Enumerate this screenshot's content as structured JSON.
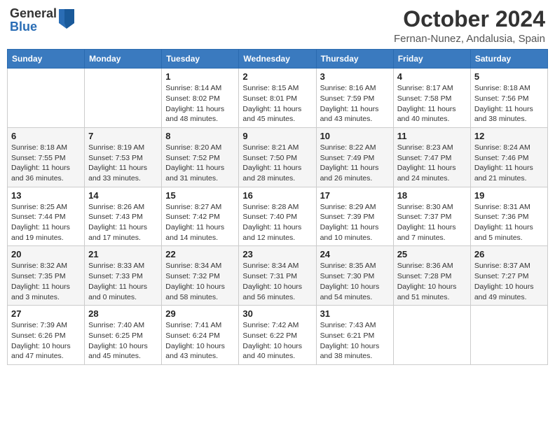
{
  "header": {
    "logo_general": "General",
    "logo_blue": "Blue",
    "month": "October 2024",
    "location": "Fernan-Nunez, Andalusia, Spain"
  },
  "days_of_week": [
    "Sunday",
    "Monday",
    "Tuesday",
    "Wednesday",
    "Thursday",
    "Friday",
    "Saturday"
  ],
  "weeks": [
    [
      {
        "day": "",
        "info": ""
      },
      {
        "day": "",
        "info": ""
      },
      {
        "day": "1",
        "info": "Sunrise: 8:14 AM\nSunset: 8:02 PM\nDaylight: 11 hours and 48 minutes."
      },
      {
        "day": "2",
        "info": "Sunrise: 8:15 AM\nSunset: 8:01 PM\nDaylight: 11 hours and 45 minutes."
      },
      {
        "day": "3",
        "info": "Sunrise: 8:16 AM\nSunset: 7:59 PM\nDaylight: 11 hours and 43 minutes."
      },
      {
        "day": "4",
        "info": "Sunrise: 8:17 AM\nSunset: 7:58 PM\nDaylight: 11 hours and 40 minutes."
      },
      {
        "day": "5",
        "info": "Sunrise: 8:18 AM\nSunset: 7:56 PM\nDaylight: 11 hours and 38 minutes."
      }
    ],
    [
      {
        "day": "6",
        "info": "Sunrise: 8:18 AM\nSunset: 7:55 PM\nDaylight: 11 hours and 36 minutes."
      },
      {
        "day": "7",
        "info": "Sunrise: 8:19 AM\nSunset: 7:53 PM\nDaylight: 11 hours and 33 minutes."
      },
      {
        "day": "8",
        "info": "Sunrise: 8:20 AM\nSunset: 7:52 PM\nDaylight: 11 hours and 31 minutes."
      },
      {
        "day": "9",
        "info": "Sunrise: 8:21 AM\nSunset: 7:50 PM\nDaylight: 11 hours and 28 minutes."
      },
      {
        "day": "10",
        "info": "Sunrise: 8:22 AM\nSunset: 7:49 PM\nDaylight: 11 hours and 26 minutes."
      },
      {
        "day": "11",
        "info": "Sunrise: 8:23 AM\nSunset: 7:47 PM\nDaylight: 11 hours and 24 minutes."
      },
      {
        "day": "12",
        "info": "Sunrise: 8:24 AM\nSunset: 7:46 PM\nDaylight: 11 hours and 21 minutes."
      }
    ],
    [
      {
        "day": "13",
        "info": "Sunrise: 8:25 AM\nSunset: 7:44 PM\nDaylight: 11 hours and 19 minutes."
      },
      {
        "day": "14",
        "info": "Sunrise: 8:26 AM\nSunset: 7:43 PM\nDaylight: 11 hours and 17 minutes."
      },
      {
        "day": "15",
        "info": "Sunrise: 8:27 AM\nSunset: 7:42 PM\nDaylight: 11 hours and 14 minutes."
      },
      {
        "day": "16",
        "info": "Sunrise: 8:28 AM\nSunset: 7:40 PM\nDaylight: 11 hours and 12 minutes."
      },
      {
        "day": "17",
        "info": "Sunrise: 8:29 AM\nSunset: 7:39 PM\nDaylight: 11 hours and 10 minutes."
      },
      {
        "day": "18",
        "info": "Sunrise: 8:30 AM\nSunset: 7:37 PM\nDaylight: 11 hours and 7 minutes."
      },
      {
        "day": "19",
        "info": "Sunrise: 8:31 AM\nSunset: 7:36 PM\nDaylight: 11 hours and 5 minutes."
      }
    ],
    [
      {
        "day": "20",
        "info": "Sunrise: 8:32 AM\nSunset: 7:35 PM\nDaylight: 11 hours and 3 minutes."
      },
      {
        "day": "21",
        "info": "Sunrise: 8:33 AM\nSunset: 7:33 PM\nDaylight: 11 hours and 0 minutes."
      },
      {
        "day": "22",
        "info": "Sunrise: 8:34 AM\nSunset: 7:32 PM\nDaylight: 10 hours and 58 minutes."
      },
      {
        "day": "23",
        "info": "Sunrise: 8:34 AM\nSunset: 7:31 PM\nDaylight: 10 hours and 56 minutes."
      },
      {
        "day": "24",
        "info": "Sunrise: 8:35 AM\nSunset: 7:30 PM\nDaylight: 10 hours and 54 minutes."
      },
      {
        "day": "25",
        "info": "Sunrise: 8:36 AM\nSunset: 7:28 PM\nDaylight: 10 hours and 51 minutes."
      },
      {
        "day": "26",
        "info": "Sunrise: 8:37 AM\nSunset: 7:27 PM\nDaylight: 10 hours and 49 minutes."
      }
    ],
    [
      {
        "day": "27",
        "info": "Sunrise: 7:39 AM\nSunset: 6:26 PM\nDaylight: 10 hours and 47 minutes."
      },
      {
        "day": "28",
        "info": "Sunrise: 7:40 AM\nSunset: 6:25 PM\nDaylight: 10 hours and 45 minutes."
      },
      {
        "day": "29",
        "info": "Sunrise: 7:41 AM\nSunset: 6:24 PM\nDaylight: 10 hours and 43 minutes."
      },
      {
        "day": "30",
        "info": "Sunrise: 7:42 AM\nSunset: 6:22 PM\nDaylight: 10 hours and 40 minutes."
      },
      {
        "day": "31",
        "info": "Sunrise: 7:43 AM\nSunset: 6:21 PM\nDaylight: 10 hours and 38 minutes."
      },
      {
        "day": "",
        "info": ""
      },
      {
        "day": "",
        "info": ""
      }
    ]
  ]
}
